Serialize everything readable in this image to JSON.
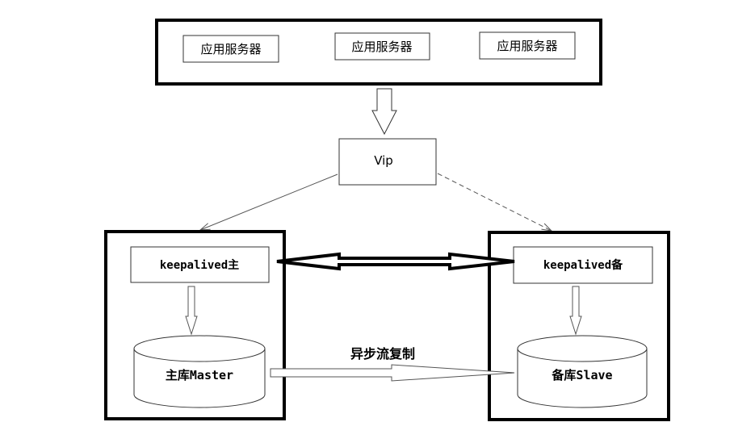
{
  "app_servers": [
    {
      "label": "应用服务器"
    },
    {
      "label": "应用服务器"
    },
    {
      "label": "应用服务器"
    }
  ],
  "vip": {
    "label": "Vip"
  },
  "master_node": {
    "keepalived_label": "keepalived主",
    "db_label": "主库Master"
  },
  "slave_node": {
    "keepalived_label": "keepalived备",
    "db_label": "备库Slave"
  },
  "replication": {
    "label": "异步流复制"
  }
}
